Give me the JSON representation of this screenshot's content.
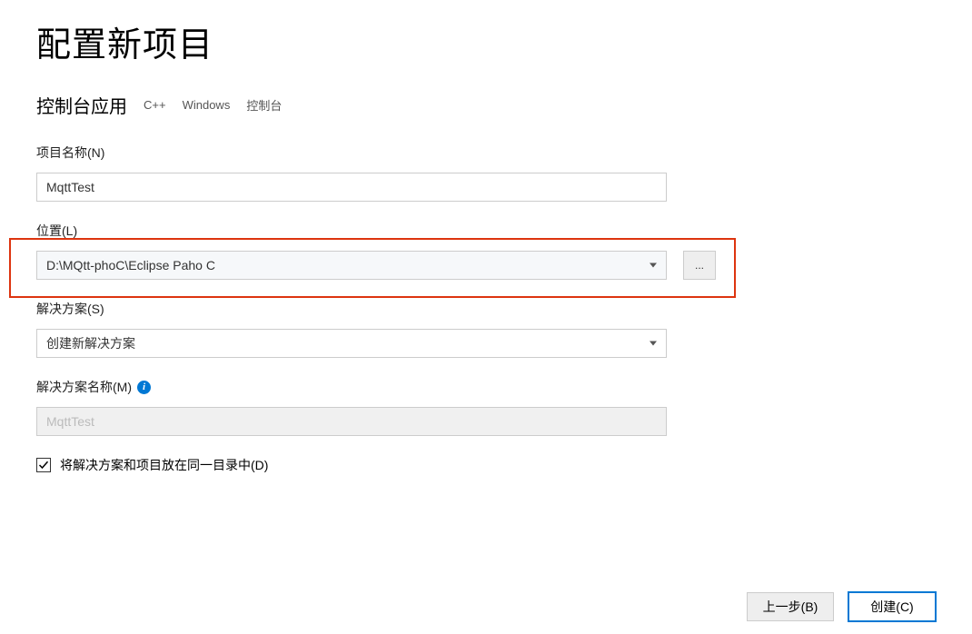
{
  "title": "配置新项目",
  "subheader": {
    "title": "控制台应用",
    "tags": [
      "C++",
      "Windows",
      "控制台"
    ]
  },
  "project_name": {
    "label": "项目名称(N)",
    "value": "MqttTest"
  },
  "location": {
    "label": "位置(L)",
    "value": "D:\\MQtt-phoC\\Eclipse Paho C",
    "browse_label": "..."
  },
  "solution": {
    "label": "解决方案(S)",
    "value": "创建新解决方案"
  },
  "solution_name": {
    "label": "解决方案名称(M)",
    "value": "MqttTest"
  },
  "checkbox": {
    "checked": true,
    "label": "将解决方案和项目放在同一目录中(D)"
  },
  "footer": {
    "back": "上一步(B)",
    "create": "创建(C)"
  }
}
